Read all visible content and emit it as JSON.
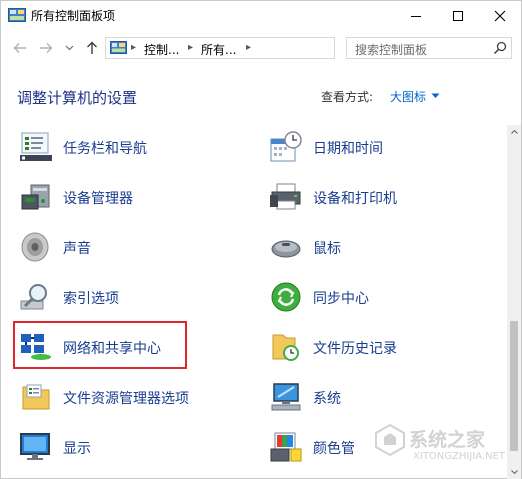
{
  "window": {
    "title": "所有控制面板项"
  },
  "address": {
    "crumbs": [
      "控制...",
      "所有..."
    ]
  },
  "search": {
    "placeholder": "搜索控制面板"
  },
  "header": {
    "title": "调整计算机的设置",
    "view_by_label": "查看方式:",
    "view_by_value": "大图标"
  },
  "items_left": [
    {
      "label": "任务栏和导航",
      "icon": "taskbar-icon"
    },
    {
      "label": "设备管理器",
      "icon": "device-manager-icon"
    },
    {
      "label": "声音",
      "icon": "speaker-icon"
    },
    {
      "label": "索引选项",
      "icon": "indexing-icon"
    },
    {
      "label": "网络和共享中心",
      "icon": "network-icon"
    },
    {
      "label": "文件资源管理器选项",
      "icon": "folder-options-icon"
    },
    {
      "label": "显示",
      "icon": "display-icon"
    }
  ],
  "items_right": [
    {
      "label": "日期和时间",
      "icon": "calendar-clock-icon"
    },
    {
      "label": "设备和打印机",
      "icon": "printer-icon"
    },
    {
      "label": "鼠标",
      "icon": "mouse-icon"
    },
    {
      "label": "同步中心",
      "icon": "sync-icon"
    },
    {
      "label": "文件历史记录",
      "icon": "file-history-icon"
    },
    {
      "label": "系统",
      "icon": "system-icon"
    },
    {
      "label": "颜色管",
      "icon": "color-management-icon"
    }
  ],
  "watermark": {
    "text": "系统之家",
    "url": "XITONGZHIJIA.NET"
  }
}
